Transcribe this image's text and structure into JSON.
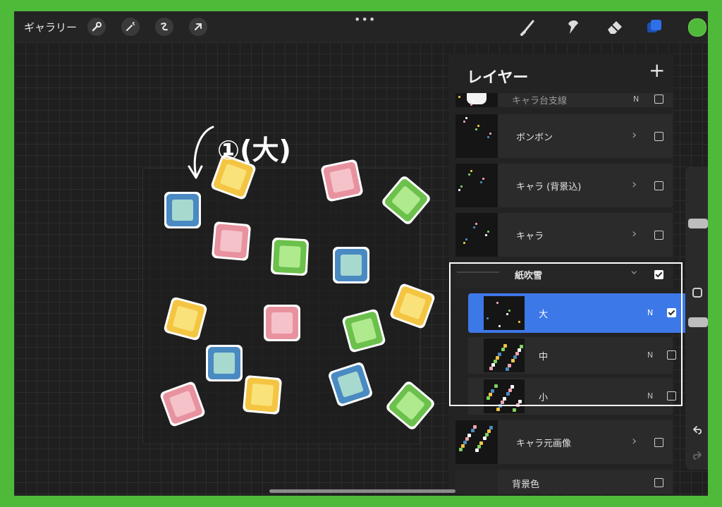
{
  "toolbar": {
    "gallery_label": "ギャラリー",
    "menu_dots": "•••",
    "left_tools": [
      {
        "icon": "wrench-icon"
      },
      {
        "icon": "magic-wand-icon"
      },
      {
        "icon": "selection-icon"
      },
      {
        "icon": "transform-arrow-icon"
      }
    ],
    "right_tools": [
      {
        "icon": "brush-icon"
      },
      {
        "icon": "smudge-icon"
      },
      {
        "icon": "eraser-icon"
      },
      {
        "icon": "layers-icon",
        "active": true,
        "color": "#2f6fe8"
      },
      {
        "icon": "color-swatch",
        "color": "#4fb93a"
      }
    ]
  },
  "annotation": {
    "text": "①(大)",
    "arrow": "curved-arrow-icon"
  },
  "layers_panel": {
    "title": "レイヤー",
    "add_label": "+",
    "layers": [
      {
        "name": "キャラ台支線",
        "blend": "N",
        "visible": false,
        "partial": true
      },
      {
        "name": "ボンボン",
        "group": true,
        "visible": false
      },
      {
        "name": "キャラ (背景込)",
        "group": true,
        "visible": false
      },
      {
        "name": "キャラ",
        "group": true,
        "visible": false
      },
      {
        "name": "紙吹雪",
        "group": true,
        "expanded": true,
        "visible": true
      },
      {
        "name": "大",
        "blend": "N",
        "visible": true,
        "selected": true
      },
      {
        "name": "中",
        "blend": "N",
        "visible": false
      },
      {
        "name": "小",
        "blend": "N",
        "visible": false
      },
      {
        "name": "キャラ元画像",
        "group": true,
        "visible": false
      },
      {
        "name": "背景色",
        "visible": false
      }
    ]
  },
  "colors": {
    "accent_blue": "#3d78e8",
    "frame_green": "#4fb93a",
    "confetti_yellow": "#f4c542",
    "confetti_pink": "#f0a5b0",
    "confetti_green": "#7fd160",
    "confetti_blue": "#4a8ac2"
  }
}
